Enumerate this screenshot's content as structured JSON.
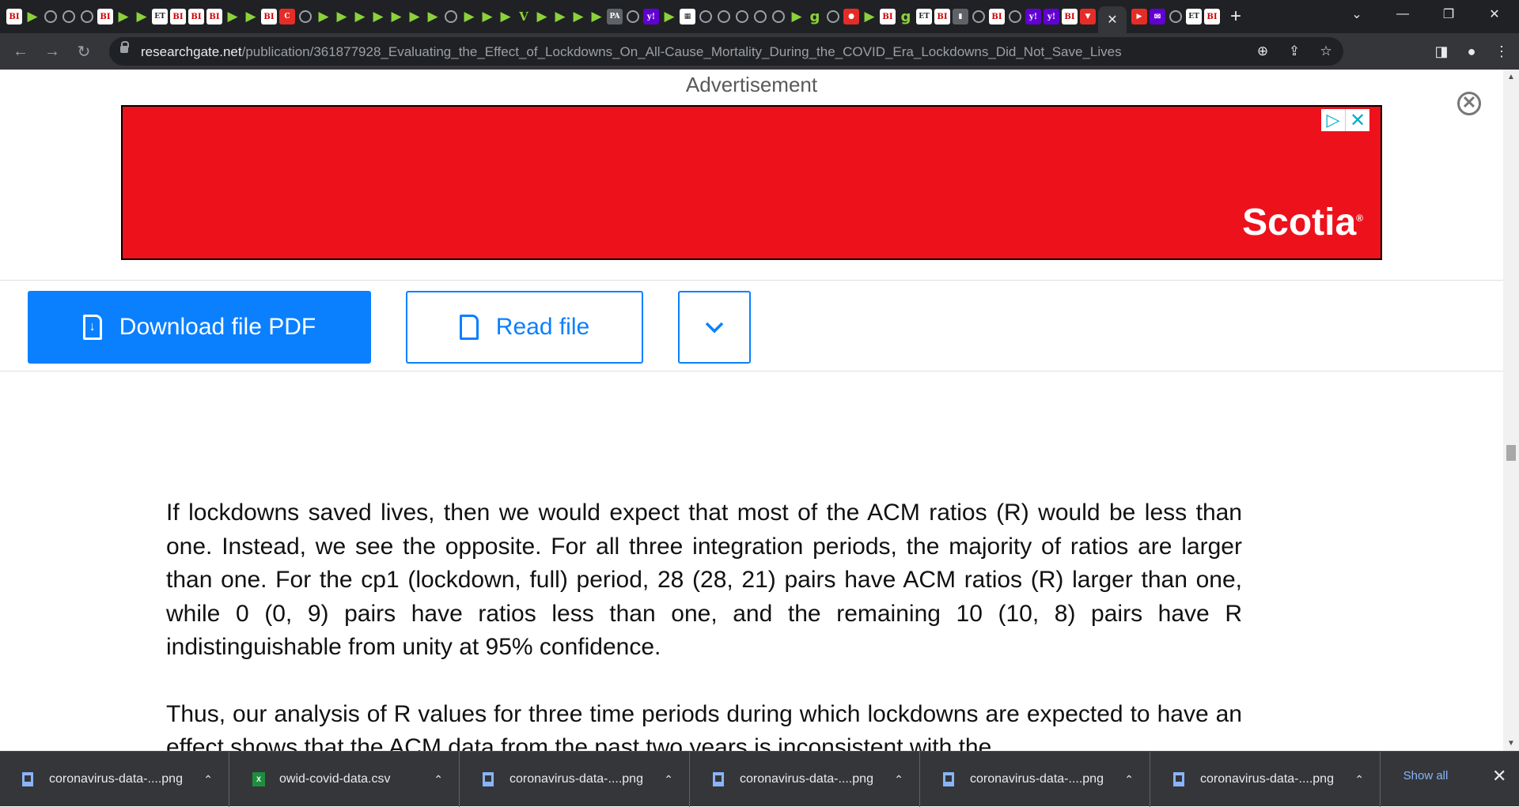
{
  "browser": {
    "tab_icons": [
      "BI",
      "play",
      "globe",
      "globe",
      "globe",
      "BI",
      "play",
      "play",
      "ET",
      "BI",
      "BI",
      "BI",
      "play",
      "play",
      "BI",
      "C",
      "globe",
      "play",
      "play",
      "play",
      "play",
      "play",
      "play",
      "play",
      "globe",
      "play",
      "play",
      "play",
      "V",
      "play",
      "play",
      "play",
      "play",
      "PA",
      "globe",
      "y!",
      "play",
      "sheet",
      "globe",
      "globe",
      "globe",
      "globe",
      "globe",
      "play",
      "g",
      "globe",
      "mic",
      "play",
      "BI",
      "g",
      "ET",
      "BI",
      "dark",
      "globe",
      "BI",
      "globe",
      "y!",
      "y!",
      "BI",
      "bookmark"
    ],
    "active_tab_close": "✕",
    "trailing_tab_icons": [
      "yt",
      "mail",
      "globe",
      "ET",
      "BI"
    ],
    "new_tab": "+",
    "url_host": "researchgate.net",
    "url_path": "/publication/361877928_Evaluating_the_Effect_of_Lockdowns_On_All-Cause_Mortality_During_the_COVID_Era_Lockdowns_Did_Not_Save_Lives"
  },
  "ad": {
    "label": "Advertisement",
    "brand": "Scotia",
    "brand_mark": "®"
  },
  "actions": {
    "download_label": "Download file PDF",
    "read_label": "Read file"
  },
  "article": {
    "paragraphs": [
      "If lockdowns saved lives, then we would expect that most of the ACM ratios (R) would be less than one. Instead, we see the opposite. For all three integration periods, the majority of ratios are larger than one. For the cp1 (lockdown, full) period, 28 (28, 21) pairs have ACM ratios (R) larger than one, while 0 (0, 9) pairs have ratios less than one, and the remaining 10 (10, 8) pairs have R indistinguishable from unity at 95% confidence.",
      "Thus, our analysis of R values for three time periods during which lockdowns are expected to have an effect shows that the ACM data from the past two years is inconsistent with the"
    ]
  },
  "downloads": {
    "items": [
      {
        "name": "coronavirus-data-....png",
        "type": "image"
      },
      {
        "name": "owid-covid-data.csv",
        "type": "csv"
      },
      {
        "name": "coronavirus-data-....png",
        "type": "image"
      },
      {
        "name": "coronavirus-data-....png",
        "type": "image"
      },
      {
        "name": "coronavirus-data-....png",
        "type": "image"
      },
      {
        "name": "coronavirus-data-....png",
        "type": "image"
      }
    ],
    "show_all": "Show all"
  },
  "colors": {
    "accent": "#0a80ff",
    "ad_red": "#ed111c",
    "chrome_dark": "#202124",
    "chrome_toolbar": "#35363a"
  }
}
